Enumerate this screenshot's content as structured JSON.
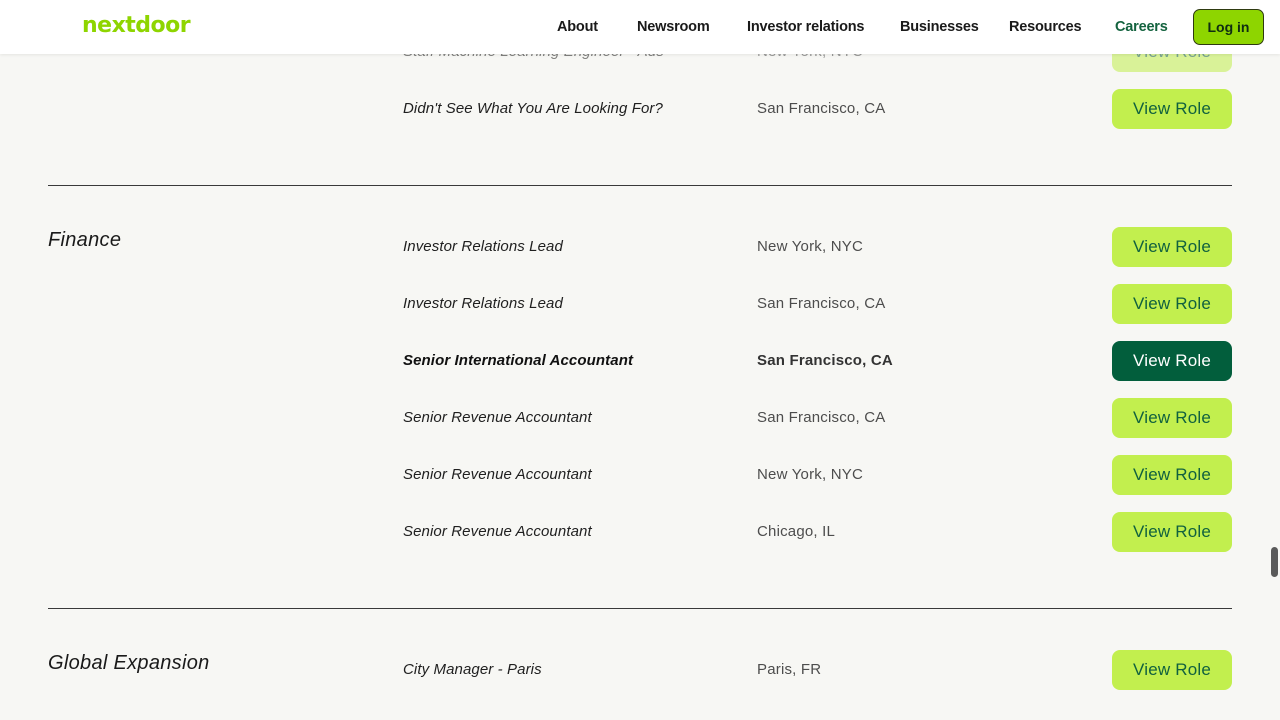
{
  "nav": {
    "logo": "nextdoor",
    "items": [
      "About",
      "Newsroom",
      "Investor relations",
      "Businesses",
      "Resources",
      "Careers"
    ],
    "login_label": "Log in"
  },
  "view_label": "View Role",
  "prev_section": {
    "jobs": [
      {
        "title": "Staff Machine Learning Engineer - Ads",
        "location": "New York, NYC"
      },
      {
        "title": "Didn't See What You Are Looking For?",
        "location": "San Francisco, CA"
      }
    ]
  },
  "finance": {
    "department": "Finance",
    "jobs": [
      {
        "title": "Investor Relations Lead",
        "location": "New York, NYC"
      },
      {
        "title": "Investor Relations Lead",
        "location": "San Francisco, CA"
      },
      {
        "title": "Senior International Accountant",
        "location": "San Francisco, CA"
      },
      {
        "title": "Senior Revenue Accountant",
        "location": "San Francisco, CA"
      },
      {
        "title": "Senior Revenue Accountant",
        "location": "New York, NYC"
      },
      {
        "title": "Senior Revenue Accountant",
        "location": "Chicago, IL"
      }
    ]
  },
  "global": {
    "department": "Global Expansion",
    "jobs": [
      {
        "title": "City Manager - Paris",
        "location": "Paris, FR"
      }
    ]
  }
}
